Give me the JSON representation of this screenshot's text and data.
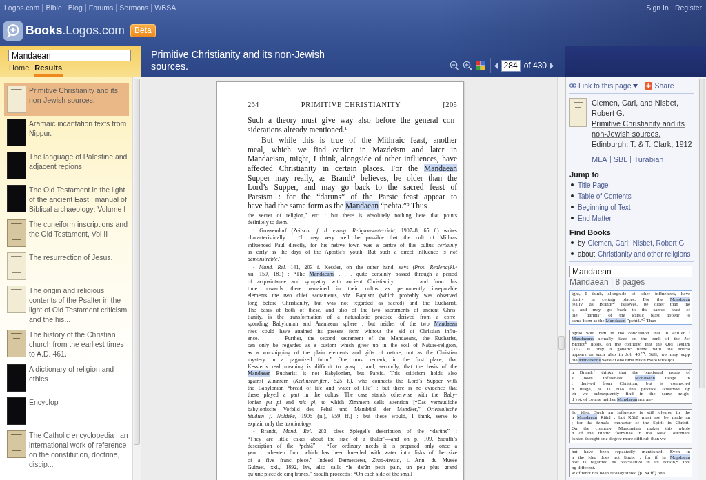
{
  "top_links": [
    "Logos.com",
    "Bible",
    "Blog",
    "Forums",
    "Sermons",
    "WBSA"
  ],
  "account_links": [
    "Sign In",
    "Register"
  ],
  "logo": {
    "text": "**Books**.Logos.com",
    "badge": "Beta"
  },
  "search": {
    "value": "Mandaean"
  },
  "tabs": [
    {
      "label": "Home",
      "selected": false
    },
    {
      "label": "Results",
      "selected": true
    }
  ],
  "book_title": "Primitive Christianity and its non-Jewish sources.",
  "pager": {
    "page": "284",
    "total": "of 430"
  },
  "results": [
    {
      "title": "Primitive Christianity and its non-Jewish sources.",
      "kind": "cream",
      "selected": true
    },
    {
      "title": "Aramaic incantation texts from Nippur.",
      "kind": "dark",
      "selected": false
    },
    {
      "title": "The language of Palestine and adjacent regions",
      "kind": "dark",
      "selected": false
    },
    {
      "title": "The Old Testament in the light of the ancient East : manual of Biblical archaeology: Volume I",
      "kind": "dark",
      "selected": false
    },
    {
      "title": "The cuneiform inscriptions and the Old Testament, Vol II",
      "kind": "aged",
      "selected": false
    },
    {
      "title": "The resurrection of Jesus.",
      "kind": "cream",
      "selected": false
    },
    {
      "title": "The origin and religious contents of the Psalter in the light of Old Testament criticism and the his...",
      "kind": "cream",
      "selected": false
    },
    {
      "title": "The history of the Christian church from the earliest times to A.D. 461.",
      "kind": "aged",
      "selected": false
    },
    {
      "title": "A dictionary of religion and ethics",
      "kind": "dark",
      "selected": false
    },
    {
      "title": "Encyclop",
      "kind": "dark",
      "selected": false
    },
    {
      "title": "The Catholic encyclopedia : an international work of reference on the constitution, doctrine, discip...",
      "kind": "aged",
      "selected": false
    }
  ],
  "page": {
    "running_head": {
      "folio": "264",
      "title": "PRIMITIVE CHRISTIANITY",
      "mark": "[205"
    },
    "paragraphs": [
      {
        "kind": "body",
        "indent": false,
        "runs": [
          {
            "text": "Such a theory must give way also before the general con-\nsiderations already mentioned.$^{1}$",
            "highlighted": false
          }
        ]
      },
      {
        "kind": "body",
        "indent": true,
        "runs": [
          {
            "text": "But while this is true of the Mithraic feast, another\nmeal, which we find earlier in Mazdeism and later in\nMandaeism, might, I think, alongside of other influences, have\naffected Christianity in certain places. For the ",
            "highlighted": false
          },
          {
            "text": "Mandaean",
            "highlighted": true
          },
          {
            "text": "\nSupper may really, as Brandt$^{2}$ believes, be older than the\nLord’s Supper, and may go back to the sacred feast of\nParsism : for the “daruns” of the Parsic feast appear to\nhave had the same form as the ",
            "highlighted": false
          },
          {
            "text": "Mandaean",
            "highlighted": true
          },
          {
            "text": " “pehtā.”$^{3}$ Thus",
            "highlighted": false
          }
        ]
      },
      {
        "kind": "footnote",
        "indent": false,
        "runs": [
          {
            "text": "the secret of religion,” etc. : but there is absolutely nothing here that points\ndefinitely to them.",
            "highlighted": false
          }
        ]
      },
      {
        "kind": "footnote",
        "indent": true,
        "runs": [
          {
            "text": "$^{1}$ Grussendorf (*Zeitschr. f. d. evang. Religionsunterricht*, 1907–8, 65 f.) writes\ncharacteristically : “It may very well be possible that the cult of Mithras\ninfluenced Paul directly, for his native town was a centre of this cultus *certainly*\nas early as the days of the Apostle’s youth. But such a direct influence *is not*\n*demonstrable*.”",
            "highlighted": false
          }
        ]
      },
      {
        "kind": "footnote",
        "indent": true,
        "runs": [
          {
            "text": "$^{2}$ *Mand. Rel.* 141, 203 f. Kessler, on the other hand, says (*Prot. Realencykl.*$^{3}$\nxii. 159, 183) : “The ",
            "highlighted": false
          },
          {
            "text": "Mandaeans",
            "highlighted": true
          },
          {
            "text": " . . . quite certainly passed through a period\nof acquaintance and sympathy with ancient Christianity . . ., and from this\ntime onwards there remained in their cultus as permanently inseparable\nelements the two chief sacraments, viz. Baptism (which probably was observed\nlong before Christianity, but was not regarded as sacred) and the Eucharist.\nThe basis of both of these, and also of the two sacraments of ancient Chris-\ntianity, is the transformation of a naturalistic practice derived from a corre-\nsponding Babylonian and Aramaean sphere : but neither of the two ",
            "highlighted": false
          },
          {
            "text": "Mandaean",
            "highlighted": true
          },
          {
            "text": "\nrites could have attained its present form without the aid of Christian influ-\nence. . . . Further, the second sacrament of the Mandaeans, the Eucharist,\ncan only be regarded as a custom which grew up in the soil of Nature-religion,\nas a worshipping of the plain elements and gifts of nature, not as the Christian\nmystery in a paganized form.” One must remark, in the first place, that\nKessler’s real meaning is difficult to grasp ; and, secondly, that the basis of the\n",
            "highlighted": false
          },
          {
            "text": "Mandaean",
            "highlighted": true
          },
          {
            "text": " Eucharist is not Babylonian, but Parsic. This criticism holds also\nagainst Zimmern (*Keilinschriften*, 525 f.), who connects the Lord’s Supper with\nthe Babylonian “bread of life and water of life” : but there is no evidence that\nthese played a part in the cultus. The case stands otherwise with the Baby-\nlonian *pit pi* and *mis pi*, to which Zimmern calls attention [“Das vermutliche\nbabylonische Vorbild des Pehtā und Mambūhā der Mandäer,” *Orientalische*\n*Studien f. Nöldeke*, 1906 (ii.), 959 ff.] : but these would, I think, serve to\nexplain only the *terminology*.",
            "highlighted": false
          }
        ]
      },
      {
        "kind": "footnote",
        "indent": true,
        "runs": [
          {
            "text": "$^{3}$ Brandt, *Mand. Rel.* 203, cites Spiegel’s description of the “darûns” :\n“They are little cakes about the size of a thaler”—and on p. 109, Siouffi’s\ndescription of the “pehtā” : “For ordinary needs it is prepared only once a\nyear : wheaten flour which has been kneaded with water into disks of the size\nof a five franc piece.” Indeed Darmesteter, *Zend-Avesta*, i. Ann. du Musée\nGuimet, xxi., 1892, lxv, also calls “le darûn petit pain, un peu plus grand\nqu’une pièce de cinq francs.” Siouffi proceeds : “On each side of the small",
            "highlighted": false
          }
        ]
      }
    ]
  },
  "actions": [
    {
      "kind": "link",
      "label": "Link to this page"
    },
    {
      "kind": "share",
      "label": "Share"
    }
  ],
  "citation": {
    "authors": "Clemen, Carl, and Nisbet, Robert G.",
    "title": "Primitive Christianity and its non-Jewish sources.",
    "publisher": "Edinburgh: T. & T. Clark, 1912"
  },
  "citation_styles": [
    "MLA",
    "SBL",
    "Turabian"
  ],
  "jump_to": {
    "heading": "Jump to",
    "items": [
      "Title Page",
      "Table of Contents",
      "Beginning of Text",
      "End Matter"
    ]
  },
  "find_books": {
    "heading": "Find Books",
    "items": [
      {
        "label": "by",
        "links": [
          "Clemen, Carl;",
          "Nisbet, Robert G"
        ]
      },
      {
        "label": "about",
        "links": [
          "Christianity and other religions"
        ]
      }
    ]
  },
  "page_search": {
    "value": "Mandaean",
    "summary": "Mandaean | 8 pages"
  },
  "hits": [
    {
      "selected": true,
      "paragraphs": [
        {
          "runs": [
            {
              "text": "ight, I think, alongside of other influences, have\ntianity in certain places. For the ",
              "highlighted": false
            },
            {
              "text": "Mandaean",
              "highlighted": true
            },
            {
              "text": "\nreally, as Brandt$^{2}$ believes, be older than the\nr, and may go back to the sacred feast of\nthe “daruns” of the Parsic feast appear to\nsame form as the ",
              "highlighted": false
            },
            {
              "text": "Mandaean",
              "highlighted": true
            },
            {
              "text": " “pehtā.”$^{3}$ Thus",
              "highlighted": false
            }
          ]
        }
      ]
    },
    {
      "selected": false,
      "paragraphs": [
        {
          "runs": [
            {
              "text": "agree with him in the conclusion that in earlier t\n",
              "highlighted": false
            },
            {
              "text": "Mandaeans",
              "highlighted": true
            },
            {
              "text": " actually lived on the bank of the Jor\nBrandt$^{1}$ holds, on the contrary, that the Old Testam\nהירדן is only a generic name with the article\nappears as such also in Job 40$^{23}$. Still, we may supp\nthe ",
              "highlighted": false
            },
            {
              "text": "Mandaeans",
              "highlighted": true
            },
            {
              "text": " were at one time much more widely s",
              "highlighted": false
            }
          ]
        }
      ]
    },
    {
      "selected": false,
      "paragraphs": [
        {
          "runs": [
            {
              "text": "a Brandt$^{1}$ thinks that the baptismal usage of\ns been influenced. ",
              "highlighted": false
            },
            {
              "text": "Mandaean",
              "highlighted": true
            },
            {
              "text": " usage in\nt derived from Christian, but is connected\nn usage, as is also the practice observed by\nch we subsequently find in the same neigh-\nd yet, of course neither ",
              "highlighted": false
            },
            {
              "text": "Mandaean",
              "highlighted": true
            },
            {
              "text": " nor any",
              "highlighted": false
            }
          ]
        }
      ]
    },
    {
      "selected": false,
      "paragraphs": [
        {
          "runs": [
            {
              "text": "lic idea. Such an influence is still clearer in the\na ",
              "highlighted": false
            },
            {
              "text": "Mandaean",
              "highlighted": true
            },
            {
              "text": " Rūhā : but Rūhā must not be made an\n; for the female character of the Spirit in Christi-\nOn the contrary, Mandaeism makes this whole\nn of the triadic formulae in the New Testament\nlonian thought one degree more difficult than we",
              "highlighted": false
            }
          ]
        }
      ]
    },
    {
      "selected": false,
      "paragraphs": [
        {
          "runs": [
            {
              "text": "hat have been repeatedly mentioned. Even in\nn the idea does not linger : for if in ",
              "highlighted": false
            },
            {
              "text": "Mandaean",
              "highlighted": true
            },
            {
              "text": "\nater is regarded as procreative in its action,$^{2}$ that\nng different.",
              "highlighted": false
            }
          ]
        },
        {
          "runs": [
            {
              "text": "w of what has been already stated (p. 34 ff.) one",
              "highlighted": false
            }
          ]
        }
      ]
    }
  ]
}
